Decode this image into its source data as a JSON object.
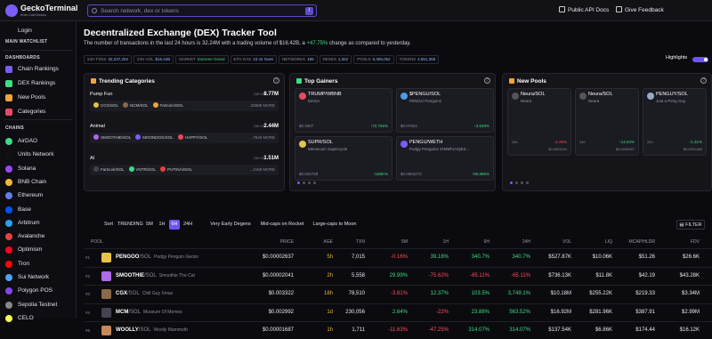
{
  "brand": {
    "name": "GeckoTerminal",
    "sub": "from CoinGecko"
  },
  "search": {
    "placeholder": "Search network, dex or tokens",
    "shortcut": "/"
  },
  "top_actions": {
    "api": "Public API Docs",
    "feedback": "Give Feedback"
  },
  "sidebar": {
    "login": "Login",
    "watchlist": "MAIN WATCHLIST",
    "dashboards_title": "DASHBOARDS",
    "dashboards": [
      "Chain Rankings",
      "DEX Rankings",
      "New Pools",
      "Categories"
    ],
    "chains_title": "CHAINS",
    "chains": [
      "AirDAO",
      "Units Network",
      "Solana",
      "BNB Chain",
      "Ethereum",
      "Base",
      "Arbitrum",
      "Avalanche",
      "Optimism",
      "Tron",
      "Sui Network",
      "Polygon POS",
      "Sepolia Testnet",
      "CELO"
    ]
  },
  "header": {
    "title": "Decentralized Exchange (DEX) Tracker Tool",
    "sub_a": "The number of transactions in the last 24 hours is 32.24M with a trading volume of $16.42B, a",
    "sub_pct": "+47.75%",
    "sub_b": "change as compared to yesterday."
  },
  "stats": [
    {
      "k": "24H TXNS",
      "v": "32,237,252"
    },
    {
      "k": "24H VOL",
      "v": "$16.42B"
    },
    {
      "k": "MARKET",
      "v": "Extreme Greed"
    },
    {
      "k": "ETH GAS",
      "v": "23.44 Gwei"
    },
    {
      "k": "NETWORKS",
      "v": "189"
    },
    {
      "k": "DEXES",
      "v": "1,362"
    },
    {
      "k": "POOLS",
      "v": "5,385,052"
    },
    {
      "k": "TOKENS",
      "v": "4,651,358"
    }
  ],
  "highlights": "Highlights",
  "trending": {
    "title": "Trending Categories",
    "vol_label": "24H VOL",
    "cats": [
      {
        "name": "Pump Fun",
        "vol": "8.77M",
        "tokens": [
          "CGX/SOL",
          "NCM/SOL",
          "Fartcoin/SOL"
        ],
        "more": "...26588 MORE"
      },
      {
        "name": "Animal",
        "vol": "2.44M",
        "tokens": [
          "SMOOTHIE/SOL",
          "MOONDOG/SOL",
          "HAPPY/SOL"
        ],
        "more": "...7846 MORE"
      },
      {
        "name": "AI",
        "vol": "1.51M",
        "tokens": [
          "Fartcoin/SOL",
          "VNTR/SOL",
          "PUTINAI/SOL"
        ],
        "more": "...2158 MORE"
      }
    ]
  },
  "gainers": {
    "title": "Top Gainers",
    "cards": [
      {
        "pair": "TRUMP/WBNB",
        "name": "MAGA",
        "price": "$0.3307",
        "change": "↑72,755%"
      },
      {
        "pair": "$PENGU/SOL",
        "name": "PENGU Penguins",
        "price": "$0.07924",
        "change": "↑3,648%"
      },
      {
        "pair": "SUPR/SOL",
        "name": "Memecoin Supercycle",
        "price": "$0.002729",
        "change": "↑166K%"
      },
      {
        "pair": "PENGU/WETH",
        "name": "Pudgy Penguins 2zMMhcVQEX...",
        "price": "$0.0004272",
        "change": "↑80,866%"
      }
    ]
  },
  "newpools": {
    "title": "New Pools",
    "cards": [
      {
        "pair": "Neura/SOL",
        "name": "Neura",
        "age": "24h",
        "change": "↓1.26%",
        "price": "$0.0001134",
        "up": false
      },
      {
        "pair": "Neura/SOL",
        "name": "Neura",
        "age": "24h",
        "change": "↑14.64%",
        "price": "$0.0005067",
        "up": true
      },
      {
        "pair": "PENGUY/SOL",
        "name": "Just a Peng Guy",
        "age": "24h",
        "change": "↑1.31%",
        "price": "$0.0001485",
        "up": true
      }
    ]
  },
  "filters": {
    "sort": "Sort",
    "trending": "TRENDING",
    "t5": "5M",
    "t1": "1H",
    "t6": "6H",
    "t24": "24H",
    "early": "Very Early Degens",
    "midcaps": "Mid-caps on Rocket",
    "large": "Large-caps to Moon",
    "filter": "FILTER"
  },
  "table": {
    "headers": [
      "POOL",
      "PRICE",
      "AGE",
      "TXN",
      "5M",
      "1H",
      "6H",
      "24H",
      "VOL",
      "LIQ",
      "MCAP/HLDR",
      "FDV"
    ],
    "rows": [
      {
        "rank": "#1",
        "base": "PENGOO",
        "quote": "/SOL",
        "full": "Pudgy Penguin Gecko",
        "price": "$0.00002637",
        "age": "5h",
        "txn": "7,015",
        "m5": "-0.16%",
        "h1": "39.18%",
        "h6": "340.7%",
        "h24": "340.7%",
        "vol": "$527.87K",
        "liq": "$10.06K",
        "mcap": "$51.26",
        "fdv": "$26.6K",
        "color": "#e8c24a"
      },
      {
        "rank": "#2",
        "base": "SMOOTHIE",
        "quote": "/SOL",
        "full": "Smoothie The Cat",
        "price": "$0.00002041",
        "age": "2h",
        "txn": "5,558",
        "m5": "29.99%",
        "h1": "-75.62%",
        "h6": "-65.11%",
        "h24": "-65.11%",
        "vol": "$736.13K",
        "liq": "$11.8K",
        "mcap": "$42.19",
        "fdv": "$43.28K",
        "color": "#b06ae8"
      },
      {
        "rank": "#3",
        "base": "CGX",
        "quote": "/SOL",
        "full": "Chill Guy Xmas",
        "price": "$0.003322",
        "age": "18h",
        "txn": "78,510",
        "m5": "-3.81%",
        "h1": "12.37%",
        "h6": "103.5%",
        "h24": "3,749.1%",
        "vol": "$10.18M",
        "liq": "$255.22K",
        "mcap": "$219.33",
        "fdv": "$3.34M",
        "color": "#8a6a4a"
      },
      {
        "rank": "#4",
        "base": "MCM",
        "quote": "/SOL",
        "full": "Museum Of Memes",
        "price": "$0.002992",
        "age": "1d",
        "txn": "230,056",
        "m5": "2.64%",
        "h1": "-22%",
        "h6": "23.88%",
        "h24": "563.52%",
        "vol": "$16.92M",
        "liq": "$281.96K",
        "mcap": "$387.91",
        "fdv": "$2.99M",
        "color": "#444450"
      },
      {
        "rank": "#5",
        "base": "WOOLLY",
        "quote": "/SOL",
        "full": "Woolly Mammoth",
        "price": "$0.00001687",
        "age": "1h",
        "txn": "1,711",
        "m5": "-11.63%",
        "h1": "-47.25%",
        "h6": "314.07%",
        "h24": "314.07%",
        "vol": "$137.54K",
        "liq": "$6.86K",
        "mcap": "$174.44",
        "fdv": "$16.12K",
        "color": "#c48a5a"
      }
    ]
  }
}
